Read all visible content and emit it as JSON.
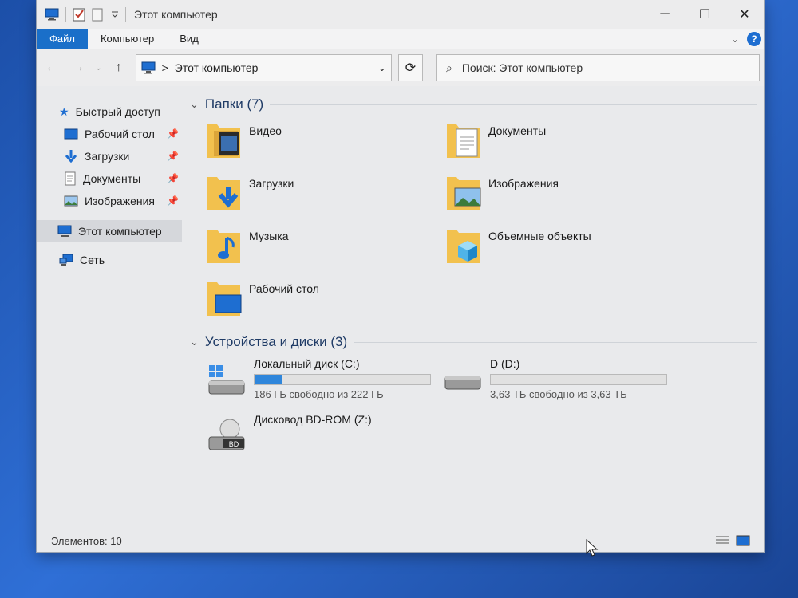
{
  "window": {
    "title": "Этот компьютер"
  },
  "ribbon": {
    "tabs": [
      "Файл",
      "Компьютер",
      "Вид"
    ]
  },
  "address": {
    "path": "Этот компьютер",
    "separator": ">"
  },
  "search": {
    "placeholder": "Поиск: Этот компьютер"
  },
  "sidebar": {
    "quick_access": "Быстрый доступ",
    "items": [
      {
        "label": "Рабочий стол",
        "icon": "desktop-icon",
        "pinned": true
      },
      {
        "label": "Загрузки",
        "icon": "download-icon",
        "pinned": true
      },
      {
        "label": "Документы",
        "icon": "document-icon",
        "pinned": true
      },
      {
        "label": "Изображения",
        "icon": "image-icon",
        "pinned": true
      }
    ],
    "this_pc": "Этот компьютер",
    "network": "Сеть"
  },
  "groups": {
    "folders_title": "Папки (7)",
    "folders": [
      {
        "label": "Видео",
        "badge": "video"
      },
      {
        "label": "Документы",
        "badge": "document"
      },
      {
        "label": "Загрузки",
        "badge": "download"
      },
      {
        "label": "Изображения",
        "badge": "image"
      },
      {
        "label": "Музыка",
        "badge": "music"
      },
      {
        "label": "Объемные объекты",
        "badge": "cube"
      },
      {
        "label": "Рабочий стол",
        "badge": "desktop"
      }
    ],
    "drives_title": "Устройства и диски (3)",
    "drives": [
      {
        "label": "Локальный диск (C:)",
        "free": "186 ГБ свободно из 222 ГБ",
        "used_fraction": 0.16,
        "icon": "windows-drive-icon"
      },
      {
        "label": "D (D:)",
        "free": "3,63 ТБ свободно из 3,63 ТБ",
        "used_fraction": 0.0,
        "icon": "hard-drive-icon"
      },
      {
        "label": "Дисковод BD-ROM (Z:)",
        "free": "",
        "icon": "bd-rom-icon",
        "bd_text": "BD"
      }
    ]
  },
  "status": {
    "items": "Элементов: 10"
  },
  "colors": {
    "accent": "#1a6fc9",
    "bar_fill": "#2f86db",
    "folder": "#f2c14e"
  }
}
